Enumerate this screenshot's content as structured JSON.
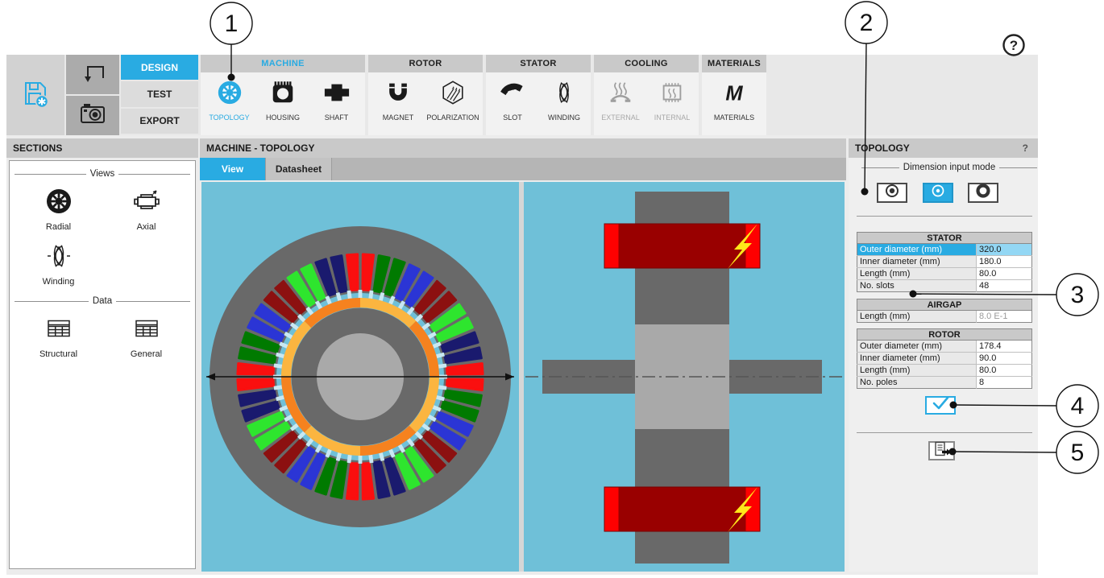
{
  "colors": {
    "accent": "#29abe2"
  },
  "callouts": [
    "1",
    "2",
    "3",
    "4",
    "5"
  ],
  "toolbar": {
    "design": "DESIGN",
    "test": "TEST",
    "export": "EXPORT",
    "help": "?",
    "groups": {
      "machine": {
        "title": "MACHINE",
        "topology": "TOPOLOGY",
        "housing": "HOUSING",
        "shaft": "SHAFT"
      },
      "rotor": {
        "title": "ROTOR",
        "magnet": "MAGNET",
        "polarization": "POLARIZATION"
      },
      "stator": {
        "title": "STATOR",
        "slot": "SLOT",
        "winding": "WINDING"
      },
      "cooling": {
        "title": "COOLING",
        "external": "EXTERNAL",
        "internal": "INTERNAL"
      },
      "materials": {
        "title": "MATERIALS",
        "materials": "MATERIALS",
        "icon_letter": "M"
      }
    }
  },
  "sections": {
    "title": "SECTIONS",
    "views_legend": "Views",
    "radial": "Radial",
    "axial": "Axial",
    "winding": "Winding",
    "data_legend": "Data",
    "structural": "Structural",
    "general": "General"
  },
  "main": {
    "title": "MACHINE - TOPOLOGY",
    "tab_view": "View",
    "tab_datasheet": "Datasheet"
  },
  "topology_panel": {
    "title": "TOPOLOGY",
    "help": "?",
    "dimension_legend": "Dimension input mode",
    "stator_table": {
      "title": "STATOR",
      "rows": [
        {
          "label": "Outer diameter (mm)",
          "value": "320.0"
        },
        {
          "label": "Inner diameter (mm)",
          "value": "180.0"
        },
        {
          "label": "Length (mm)",
          "value": "80.0"
        },
        {
          "label": "No. slots",
          "value": "48"
        }
      ]
    },
    "airgap_table": {
      "title": "AIRGAP",
      "rows": [
        {
          "label": "Length (mm)",
          "value": "8.0 E-1"
        }
      ]
    },
    "rotor_table": {
      "title": "ROTOR",
      "rows": [
        {
          "label": "Outer diameter (mm)",
          "value": "178.4"
        },
        {
          "label": "Inner diameter (mm)",
          "value": "90.0"
        },
        {
          "label": "Length (mm)",
          "value": "80.0"
        },
        {
          "label": "No. poles",
          "value": "8"
        }
      ]
    }
  },
  "machine_view": {
    "background": "#6fc0d8",
    "steel": "#696969",
    "shaft": "#a9a9a9",
    "airgap_tick": "#c9e8f2",
    "slot_color_sequence": [
      "#fa0f0f",
      "#007a00",
      "#2b35d5",
      "#8c1010",
      "#2ee52e",
      "#1a1a6e"
    ],
    "slot_count": 48,
    "pole_count": 8,
    "magnet_colors": [
      "#fbb540",
      "#f5821f"
    ],
    "coil_dark": "#990000",
    "coil_bright": "#fe0000",
    "coil_edge": "#7a0000",
    "bolt": "#ffe81a"
  }
}
